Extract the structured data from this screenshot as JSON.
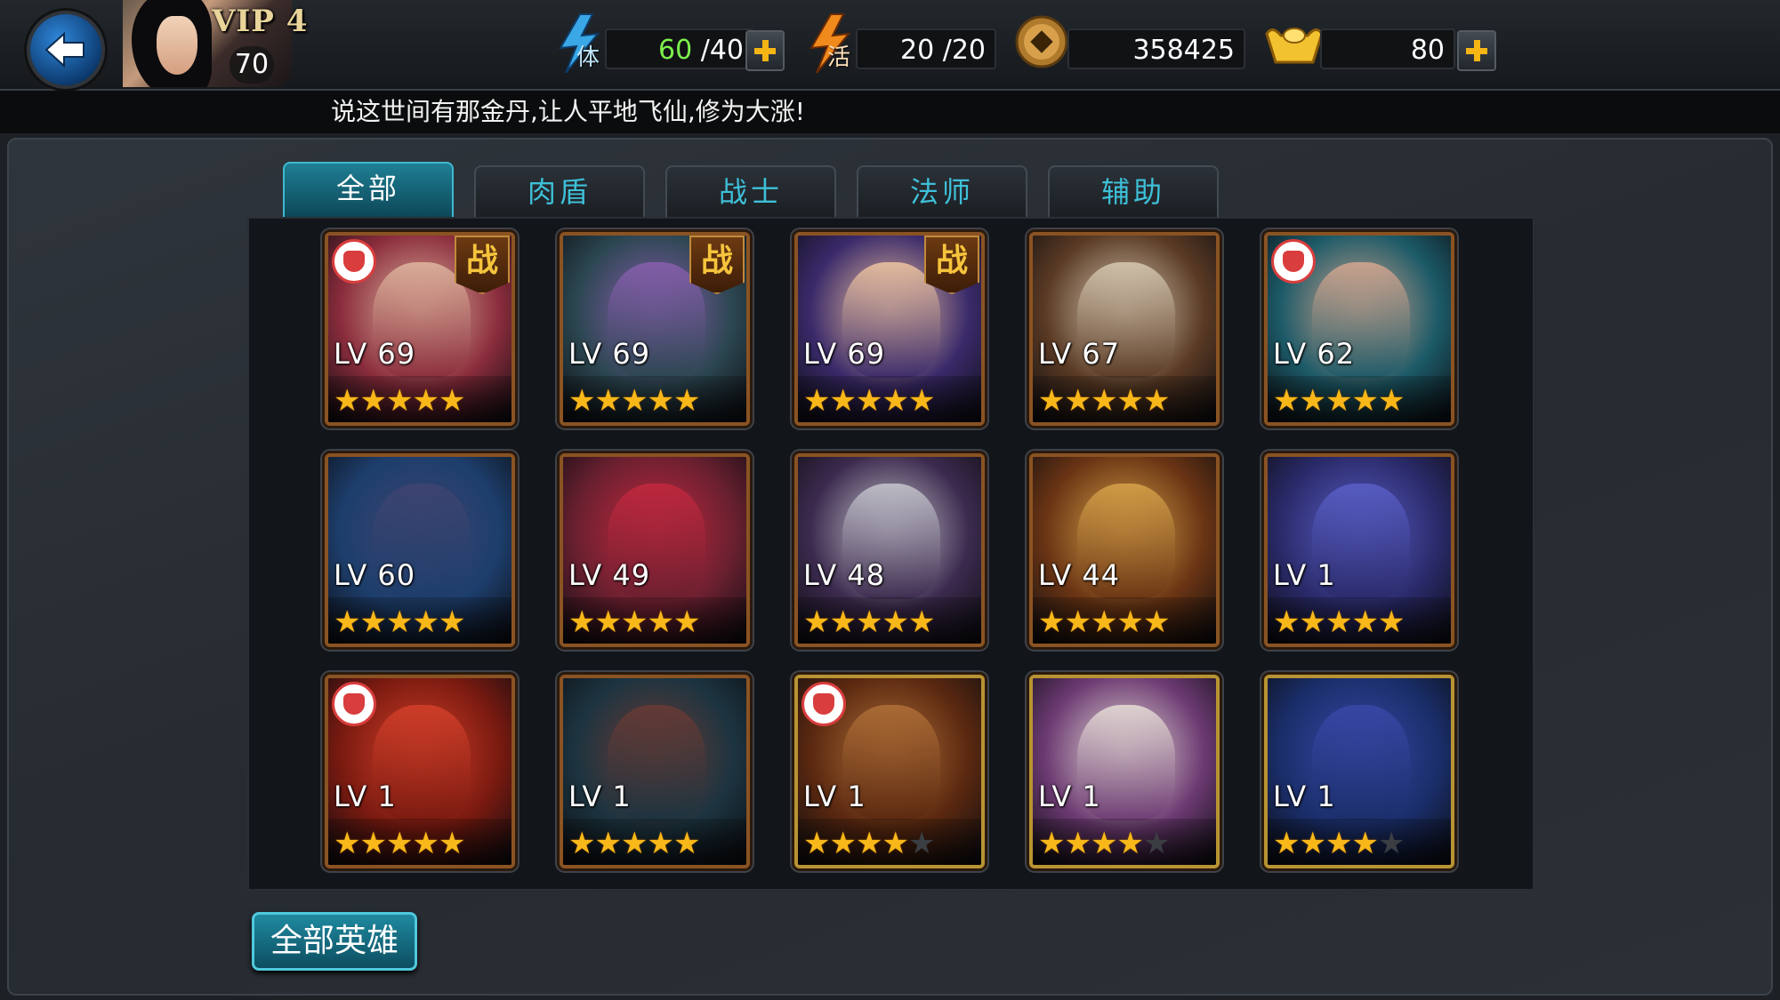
{
  "header": {
    "vip_label": "VIP 4",
    "player_level": "70",
    "stamina_current": "60",
    "stamina_max": " /40",
    "activity_value": "20 /20",
    "copper_value": "358425",
    "gold_value": "80",
    "stamina_icon_char": "体",
    "activity_icon_char": "活"
  },
  "announcement": "说这世间有那金丹,让人平地飞仙,修为大涨!",
  "tabs": [
    {
      "label": "全部",
      "active": true
    },
    {
      "label": "肉盾",
      "active": false
    },
    {
      "label": "战士",
      "active": false
    },
    {
      "label": "法师",
      "active": false
    },
    {
      "label": "辅助",
      "active": false
    }
  ],
  "heroes": [
    {
      "lv": "LV 69",
      "stars": 5,
      "badge_zhan": "战",
      "armor": true,
      "bg": "#8a2c3c",
      "tone": "#e0b8a0"
    },
    {
      "lv": "LV 69",
      "stars": 5,
      "badge_zhan": "战",
      "armor": false,
      "bg": "#2b4650",
      "tone": "#8a5fb0"
    },
    {
      "lv": "LV 69",
      "stars": 5,
      "badge_zhan": "战",
      "armor": false,
      "bg": "#3a2a6a",
      "tone": "#f2c7a2"
    },
    {
      "lv": "LV 67",
      "stars": 5,
      "badge_zhan": "",
      "armor": false,
      "bg": "#5a3a24",
      "tone": "#d9cbb5"
    },
    {
      "lv": "LV 62",
      "stars": 5,
      "badge_zhan": "",
      "armor": true,
      "bg": "#1c5a68",
      "tone": "#d8a890"
    },
    {
      "lv": "LV 60",
      "stars": 5,
      "badge_zhan": "",
      "armor": false,
      "bg": "#1d3e6c",
      "tone": "#3f4470"
    },
    {
      "lv": "LV 49",
      "stars": 5,
      "badge_zhan": "",
      "armor": false,
      "bg": "#6a2030",
      "tone": "#c4283e"
    },
    {
      "lv": "LV 48",
      "stars": 5,
      "badge_zhan": "",
      "armor": false,
      "bg": "#3c2a4e",
      "tone": "#c8c8d0"
    },
    {
      "lv": "LV 44",
      "stars": 5,
      "badge_zhan": "",
      "armor": false,
      "bg": "#6a3414",
      "tone": "#d8a44a"
    },
    {
      "lv": "LV 1",
      "stars": 5,
      "badge_zhan": "",
      "armor": false,
      "bg": "#2a2a6a",
      "tone": "#5a60c8"
    },
    {
      "lv": "LV 1",
      "stars": 5,
      "badge_zhan": "",
      "armor": true,
      "bg": "#7a1a10",
      "tone": "#d4402a"
    },
    {
      "lv": "LV 1",
      "stars": 5,
      "badge_zhan": "",
      "armor": false,
      "bg": "#1c3440",
      "tone": "#6a3a34"
    },
    {
      "lv": "LV 1",
      "stars": 4,
      "badge_zhan": "",
      "armor": true,
      "bg": "#5a2810",
      "tone": "#b07038"
    },
    {
      "lv": "LV 1",
      "stars": 4,
      "badge_zhan": "",
      "armor": false,
      "bg": "#6c3a72",
      "tone": "#e8e0d8"
    },
    {
      "lv": "LV 1",
      "stars": 4,
      "badge_zhan": "",
      "armor": false,
      "bg": "#1a2e6a",
      "tone": "#3a48a8"
    }
  ],
  "bottom_button": "全部英雄",
  "colors": {
    "accent_cyan": "#3ec0d8",
    "star_gold": "#f9b81a",
    "plus_gold": "#f5b515",
    "stamina_green": "#7df04d"
  },
  "icons": [
    "back-arrow-icon",
    "stamina-lightning-icon",
    "activity-lightning-icon",
    "copper-coin-icon",
    "gold-ingot-icon",
    "plus-icon",
    "star-icon",
    "battle-badge-icon",
    "armor-badge-icon"
  ]
}
